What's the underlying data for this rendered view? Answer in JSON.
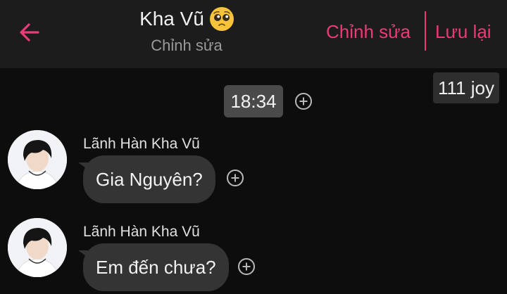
{
  "header": {
    "title": "Kha Vũ",
    "subtitle": "Chỉnh sửa",
    "edit_label": "Chỉnh sửa",
    "save_label": "Lưu lại",
    "accent_color": "#ea3b78",
    "emoji_icon": "pleading-face-emoji"
  },
  "name_tag": "111 joy",
  "time_badge": "18:34",
  "messages": [
    {
      "sender": "Lãnh Hàn Kha Vũ",
      "text": "Gia Nguyên?"
    },
    {
      "sender": "Lãnh Hàn Kha Vũ",
      "text": "Em đến chưa?"
    }
  ]
}
